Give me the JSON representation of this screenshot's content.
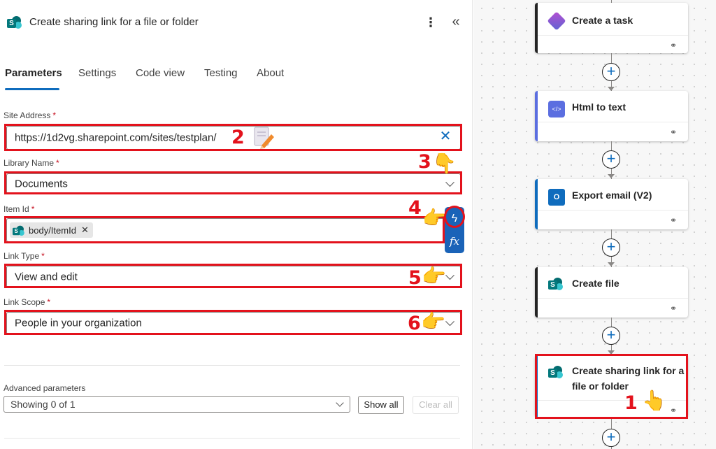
{
  "panel": {
    "title": "Create sharing link for a file or folder",
    "more_icon": "more-vertical-icon",
    "collapse_icon": "double-chevron-left-icon"
  },
  "tabs": [
    {
      "label": "Parameters",
      "active": true
    },
    {
      "label": "Settings",
      "active": false
    },
    {
      "label": "Code view",
      "active": false
    },
    {
      "label": "Testing",
      "active": false
    },
    {
      "label": "About",
      "active": false
    }
  ],
  "fields": {
    "site_address": {
      "label": "Site Address",
      "required_mark": "*",
      "value": "https://1d2vg.sharepoint.com/sites/testplan/"
    },
    "library_name": {
      "label": "Library Name",
      "required_mark": "*",
      "value": "Documents"
    },
    "item_id": {
      "label": "Item Id",
      "required_mark": "*",
      "token": "body/ItemId"
    },
    "link_type": {
      "label": "Link Type",
      "required_mark": "*",
      "value": "View and edit"
    },
    "link_scope": {
      "label": "Link Scope",
      "required_mark": "*",
      "value": "People in your organization"
    }
  },
  "dynamic_buttons": {
    "dynamic_content_icon": "lightning-icon",
    "expression_label": "fx"
  },
  "advanced": {
    "label": "Advanced parameters",
    "select_value": "Showing 0 of 1",
    "show_all": "Show all",
    "clear_all": "Clear all"
  },
  "annotations": {
    "step_1": "1",
    "step_2": "2",
    "step_3": "3",
    "step_4": "4",
    "step_5": "5",
    "step_6": "6",
    "pointer_glyph": "👉",
    "pointer_down_glyph": "👇",
    "pointer_up_glyph": "👆"
  },
  "flow": {
    "cards": [
      {
        "title": "Create a task",
        "icon": "planner-icon",
        "accent": "#242424"
      },
      {
        "title": "Html to text",
        "icon": "html-to-text-icon",
        "accent": "#5b6ee0"
      },
      {
        "title": "Export email (V2)",
        "icon": "outlook-icon",
        "accent": "#0f6cbd"
      },
      {
        "title": "Create file",
        "icon": "sharepoint-icon",
        "accent": "#242424"
      },
      {
        "title": "Create sharing link for a file or folder",
        "icon": "sharepoint-icon",
        "accent": "#0f6cbd"
      }
    ]
  },
  "colors": {
    "accent": "#0f6cbd",
    "highlight": "#e3121c",
    "sharepoint": "#03787c"
  }
}
